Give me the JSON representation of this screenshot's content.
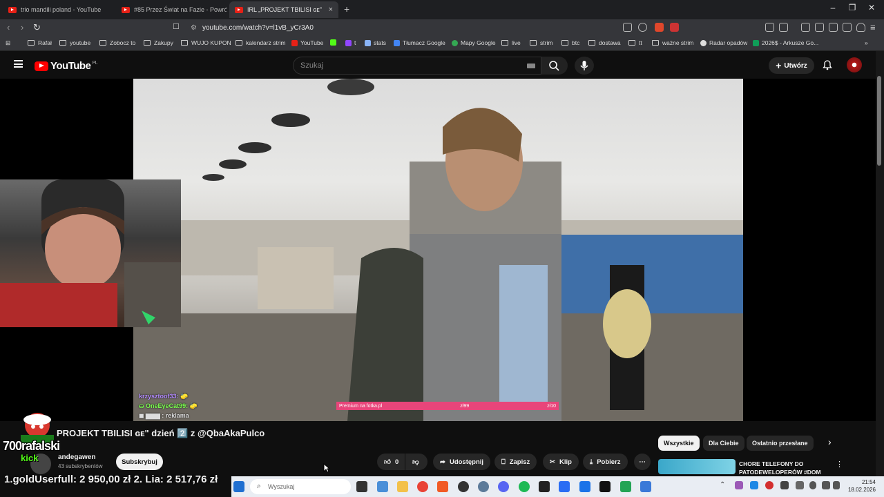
{
  "browser": {
    "tabs": [
      {
        "label": "trio mandili poland - YouTube"
      },
      {
        "label": "#85 Przez Świat na Fazie - Powrót - G"
      },
      {
        "label": "IRL „PROJEKT TBILISI ɢᴇ\" dzie"
      }
    ],
    "url": "youtube.com/watch?v=l1vB_yCr3A0",
    "bookmarks": [
      "Rafał",
      "youtube",
      "Zobocz to",
      "Zakupy",
      "WUJO KUPON",
      "kalendarz strim",
      "YouTube",
      "t",
      "stats",
      "Tłumacz Google",
      "Mapy Google",
      "live",
      "strim",
      "btc",
      "dostawa",
      "tt",
      "ważne strim",
      "Radar opadów",
      "2026$ - Arkusze Go..."
    ]
  },
  "youtube": {
    "logo_text": "YouTube",
    "region": "PL",
    "search_placeholder": "Szukaj",
    "create_label": "Utwórz"
  },
  "video": {
    "title": "PROJEKT TBILISI ɢᴇ\" dzień 2️⃣ z @QbaAkaPulco",
    "channel": "andegawen",
    "subscribers": "43 subskrybentów",
    "subscribe_label": "Subskrybuj",
    "likes": "0",
    "share_label": "Udostępnij",
    "save_label": "Zapisz",
    "clip_label": "Klip",
    "download_label": "Pobierz",
    "chat": [
      {
        "user": "krzysztoof33:",
        "color": "#b38bff"
      },
      {
        "user": "OneEyeCat99:",
        "color": "#7cff50"
      },
      {
        "user": "reklama",
        "color": "#ffffff"
      }
    ],
    "overlay_banner": {
      "left": "Premium na fotka.pl",
      "mid": "zł99",
      "right": "zł10"
    }
  },
  "sidebar": {
    "chips": [
      "Wszystkie",
      "Dla Ciebie",
      "Ostatnio przesłane"
    ],
    "next_video_title": "CHORE TELEFONY DO PATODEWELOPERÓW #DOM"
  },
  "overlay": {
    "logo_text": "700rafalski",
    "kick_text": "kick",
    "ticker": "1.goldUserfull: 2 950,00 zł   2. Lia: 2 517,76 zł"
  },
  "taskbar": {
    "search_placeholder": "Wyszukaj",
    "time": "21:54",
    "date": "18.02.2026"
  }
}
